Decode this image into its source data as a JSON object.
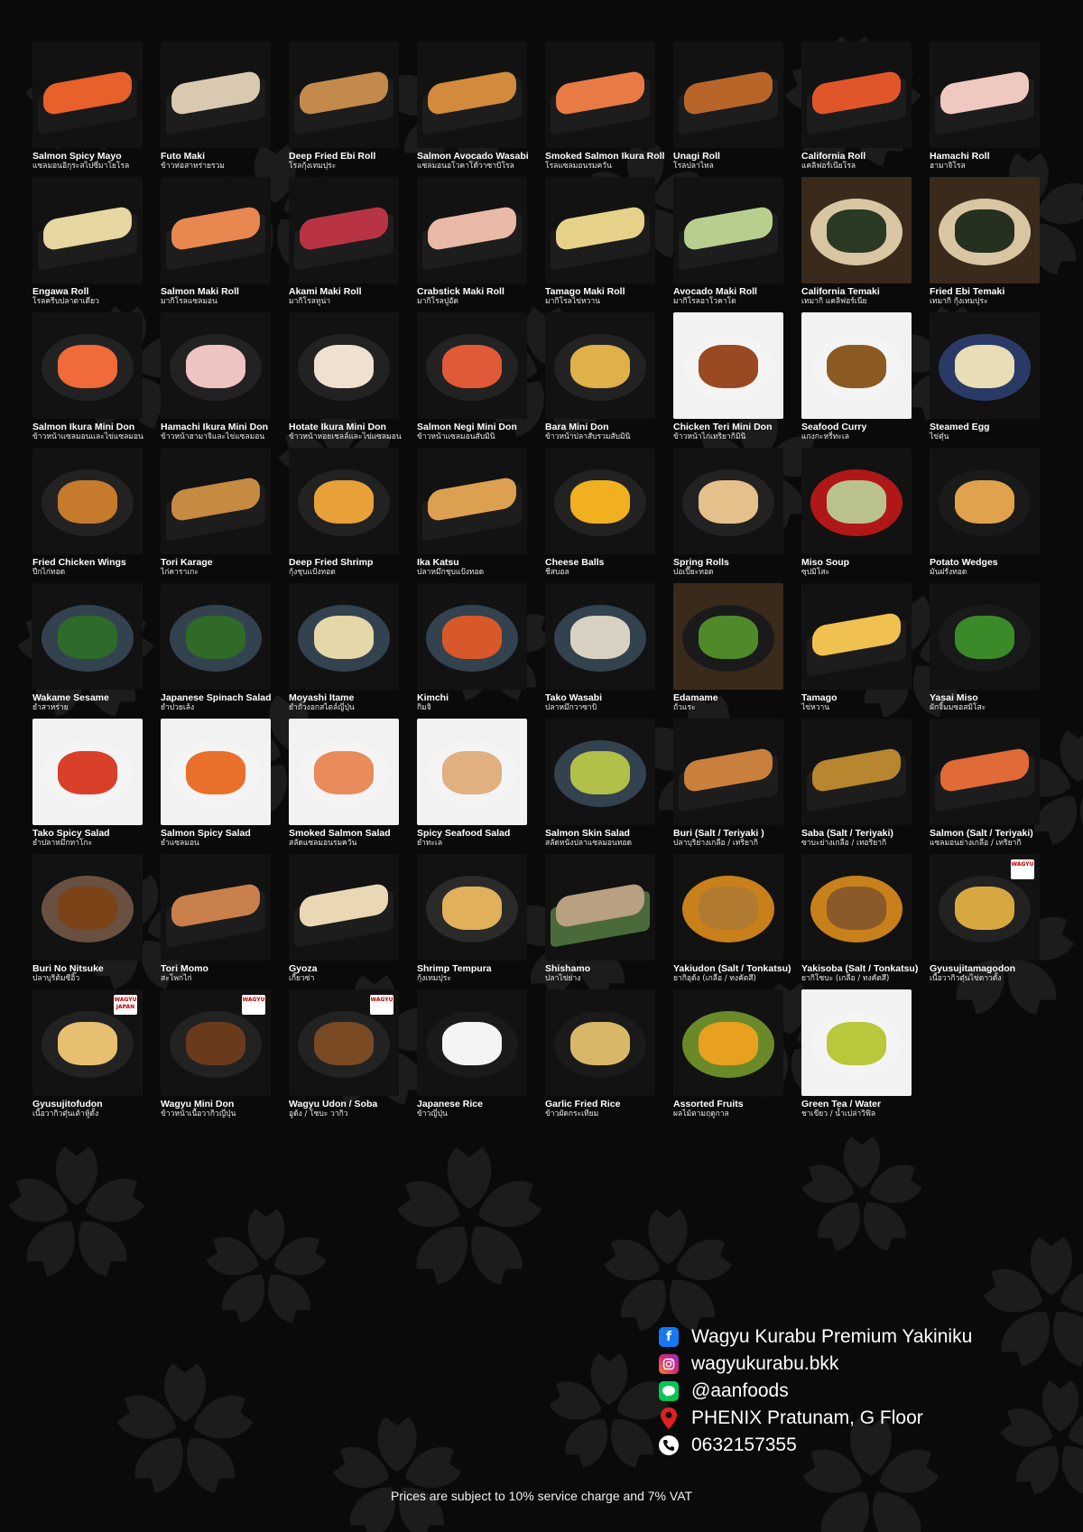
{
  "menu": {
    "items": [
      {
        "name": "Salmon Spicy Mayo",
        "thai": "แซลมอนอิกุระสไปซี่มาโยโรล",
        "style": "tray",
        "food": "#e8602a",
        "plate": "#1a1a1a"
      },
      {
        "name": "Futo Maki",
        "thai": "ข้าวห่อสาหร่ายรวม",
        "style": "tray",
        "food": "#d9c9b0",
        "plate": "#1d1d1d"
      },
      {
        "name": "Deep Fried Ebi Roll",
        "thai": "โรลกุ้งเทมปุระ",
        "style": "tray",
        "food": "#c48a4c",
        "plate": "#1d1d1d"
      },
      {
        "name": "Salmon Avocado Wasabi",
        "thai": "แซลมอนอโวคาโด้วาซาบิโรล",
        "style": "tray",
        "food": "#d28a3c",
        "plate": "#1d1d1d"
      },
      {
        "name": "Smoked Salmon Ikura Roll",
        "thai": "โรลแซลมอนรมควัน",
        "style": "tray",
        "food": "#e87b45",
        "plate": "#1d1d1d"
      },
      {
        "name": "Unagi Roll",
        "thai": "โรลปลาไหล",
        "style": "tray",
        "food": "#b8652a",
        "plate": "#1d1d1d"
      },
      {
        "name": "California Roll",
        "thai": "แคลิฟอร์เนียโรล",
        "style": "tray",
        "food": "#e0562a",
        "plate": "#1d1d1d"
      },
      {
        "name": "Hamachi Roll",
        "thai": "ฮามาจิโรล",
        "style": "tray",
        "food": "#efc9c0",
        "plate": "#1d1d1d"
      },
      {
        "name": "Engawa Roll",
        "thai": "โรลครีบปลาตาเดียว",
        "style": "tray",
        "food": "#e6d7a0",
        "plate": "#1d1d1d"
      },
      {
        "name": "Salmon Maki Roll",
        "thai": "มากิโรลแซลมอน",
        "style": "tray",
        "food": "#e8874f",
        "plate": "#1d1d1d"
      },
      {
        "name": "Akami Maki Roll",
        "thai": "มากิโรลทูน่า",
        "style": "tray",
        "food": "#b83444",
        "plate": "#1d1d1d"
      },
      {
        "name": "Crabstick Maki Roll",
        "thai": "มากิโรลปูอัด",
        "style": "tray",
        "food": "#e8b9a6",
        "plate": "#1d1d1d"
      },
      {
        "name": "Tamago Maki Roll",
        "thai": "มากิโรลไข่หวาน",
        "style": "tray",
        "food": "#e6d189",
        "plate": "#1d1d1d"
      },
      {
        "name": "Avocado Maki Roll",
        "thai": "มากิโรลอาโวคาโด",
        "style": "tray",
        "food": "#b6cf8f",
        "plate": "#1d1d1d"
      },
      {
        "name": "California Temaki",
        "thai": "เทมากิ แคลิฟอร์เนีย",
        "style": "wood",
        "food": "#2b3a22",
        "plate": "#d8c6a2"
      },
      {
        "name": "Fried Ebi Temaki",
        "thai": "เทมากิ กุ้งเทมปุระ",
        "style": "wood",
        "food": "#26301e",
        "plate": "#d8c6a2"
      },
      {
        "name": "Salmon Ikura Mini Don",
        "thai": "ข้าวหน้าแซลมอนและไข่แซลมอน",
        "style": "bowl",
        "food": "#f06a3a",
        "plate": "#222"
      },
      {
        "name": "Hamachi Ikura Mini Don",
        "thai": "ข้าวหน้าฮามาจิและไข่แซลมอน",
        "style": "bowl",
        "food": "#f0c3c3",
        "plate": "#222"
      },
      {
        "name": "Hotate Ikura Mini Don",
        "thai": "ข้าวหน้าหอยเชลล์และไข่แซลมอน",
        "style": "bowl",
        "food": "#efe1cf",
        "plate": "#222"
      },
      {
        "name": "Salmon Negi Mini Don",
        "thai": "ข้าวหน้าแซลมอนสับมินิ",
        "style": "bowl",
        "food": "#e05a38",
        "plate": "#222"
      },
      {
        "name": "Bara Mini Don",
        "thai": "ข้าวหน้าปลาสับรวมสับมินิ",
        "style": "bowl",
        "food": "#e0b04a",
        "plate": "#222"
      },
      {
        "name": "Chicken Teri Mini Don",
        "thai": "ข้าวหน้าไก่เทริยากิมินิ",
        "style": "white-plate",
        "food": "#9a4a22",
        "plate": "#f4f4f4"
      },
      {
        "name": "Seafood Curry",
        "thai": "แกงกะหรี่ทะเล",
        "style": "white-plate",
        "food": "#8a5a22",
        "plate": "#f4f4f4"
      },
      {
        "name": "Steamed Egg",
        "thai": "ไข่ตุ๋น",
        "style": "bowl",
        "food": "#e8ddb6",
        "plate": "#2a3a66"
      },
      {
        "name": "Fried Chicken Wings",
        "thai": "ปีกไก่ทอด",
        "style": "bowl",
        "food": "#c57a2c",
        "plate": "#222"
      },
      {
        "name": "Tori Karage",
        "thai": "ไก่คาราเกะ",
        "style": "tray",
        "food": "#c78a42",
        "plate": "#1d1d1d"
      },
      {
        "name": "Deep Fried Shrimp",
        "thai": "กุ้งชุบแป้งทอด",
        "style": "bowl",
        "food": "#e8a038",
        "plate": "#222"
      },
      {
        "name": "Ika Katsu",
        "thai": "ปลาหมึกชุบแป้งทอด",
        "style": "tray",
        "food": "#dca050",
        "plate": "#1d1d1d"
      },
      {
        "name": "Cheese Balls",
        "thai": "ชีสบอล",
        "style": "bowl",
        "food": "#f0b020",
        "plate": "#222"
      },
      {
        "name": "Spring Rolls",
        "thai": "ปอเปี๊ยะทอด",
        "style": "bowl",
        "food": "#e6c08a",
        "plate": "#222"
      },
      {
        "name": "Miso Soup",
        "thai": "ซุปมิโสะ",
        "style": "bowl",
        "food": "#b8c28a",
        "plate": "#b01818"
      },
      {
        "name": "Potato Wedges",
        "thai": "มันฝรั่งทอด",
        "style": "bowl",
        "food": "#e0a24c",
        "plate": "#1a1a1a"
      },
      {
        "name": "Wakame Sesame",
        "thai": "ยำสาหร่าย",
        "style": "bowl",
        "food": "#2e6a2a",
        "plate": "#33424f"
      },
      {
        "name": "Japanese Spinach Salad",
        "thai": "ยำปวยเล้ง",
        "style": "bowl",
        "food": "#2f6a28",
        "plate": "#33424f"
      },
      {
        "name": "Moyashi Itame",
        "thai": "ยำถั่วงอกสไตล์ญี่ปุ่น",
        "style": "bowl",
        "food": "#e6d7a8",
        "plate": "#33424f"
      },
      {
        "name": "Kimchi",
        "thai": "กิมจิ",
        "style": "bowl",
        "food": "#d8582a",
        "plate": "#33424f"
      },
      {
        "name": "Tako Wasabi",
        "thai": "ปลาหมึกวาซาบิ",
        "style": "bowl",
        "food": "#d8d0c0",
        "plate": "#33424f"
      },
      {
        "name": "Edamame",
        "thai": "ถั่วแระ",
        "style": "wood",
        "food": "#4e8a2a",
        "plate": "#1a1a1a"
      },
      {
        "name": "Tamago",
        "thai": "ไข่หวาน",
        "style": "tray",
        "food": "#f0c050",
        "plate": "#1d1d1d"
      },
      {
        "name": "Yasai Miso",
        "thai": "ผักจิ้มมซอสมิโสะ",
        "style": "bowl",
        "food": "#3a8a2a",
        "plate": "#1a1a1a"
      },
      {
        "name": "Tako Spicy Salad",
        "thai": "ยำปลาหมึกทาโกะ",
        "style": "white-plate",
        "food": "#d8402a",
        "plate": "#f4f4f4"
      },
      {
        "name": "Salmon Spicy Salad",
        "thai": "ยำแซลมอน",
        "style": "white-plate",
        "food": "#e8702a",
        "plate": "#f4f4f4"
      },
      {
        "name": "Smoked Salmon Salad",
        "thai": "สลัดแซลมอนรมควัน",
        "style": "white-plate",
        "food": "#e88a5a",
        "plate": "#f4f4f4"
      },
      {
        "name": "Spicy Seafood Salad",
        "thai": "ยำทะเล",
        "style": "white-plate",
        "food": "#e0b080",
        "plate": "#f4f4f4"
      },
      {
        "name": "Salmon Skin Salad",
        "thai": "สลัดหนังปลาแซลมอนทอด",
        "style": "bowl",
        "food": "#b0c048",
        "plate": "#33424f"
      },
      {
        "name": "Buri (Salt / Teriyaki )",
        "thai": "ปลาบุริย่างเกลือ / เทริยากิ",
        "style": "tray",
        "food": "#c9803c",
        "plate": "#1d1d1d"
      },
      {
        "name": "Saba (Salt / Teriyaki)",
        "thai": "ซาบะย่างเกลือ / เทอริยากิ",
        "style": "tray",
        "food": "#b8862e",
        "plate": "#1d1d1d"
      },
      {
        "name": "Salmon (Salt / Teriyaki)",
        "thai": "แซลมอนย่างเกลือ / เทริยากิ",
        "style": "tray",
        "food": "#e06a38",
        "plate": "#1d1d1d"
      },
      {
        "name": "Buri No Nitsuke",
        "thai": "ปลาบุริต้มซีอิ๊ว",
        "style": "bowl",
        "food": "#7a4418",
        "plate": "#6a5040"
      },
      {
        "name": "Tori Momo",
        "thai": "สะโพกไก่",
        "style": "tray",
        "food": "#c9804c",
        "plate": "#1d1d1d"
      },
      {
        "name": "Gyoza",
        "thai": "เกี๊ยวซ่า",
        "style": "tray",
        "food": "#ead8b4",
        "plate": "#1d1d1d"
      },
      {
        "name": "Shrimp Tempura",
        "thai": "กุ้งเทมปุระ",
        "style": "bowl",
        "food": "#e0b05a",
        "plate": "#2a2a2a"
      },
      {
        "name": "Shishamo",
        "thai": "ปลาไข่ย่าง",
        "style": "tray",
        "food": "#b8a080",
        "plate": "#4a6a3a"
      },
      {
        "name": "Yakiudon (Salt / Tonkatsu)",
        "thai": "ยากิอุด้ง (เกลือ / ทงคัตสึ)",
        "style": "bowl",
        "food": "#b07a30",
        "plate": "#c8801a"
      },
      {
        "name": "Yakisoba (Salt / Tonkatsu)",
        "thai": "ยากิโซบะ (เกลือ / ทงคัตสึ)",
        "style": "bowl",
        "food": "#8a5a2a",
        "plate": "#c8801a"
      },
      {
        "name": "Gyusujitamagodon",
        "thai": "เนื้อวากิวตุ๋นไข่ดาวดั้ง",
        "style": "bowl",
        "food": "#d8a840",
        "plate": "#222",
        "badge": "WAGYU"
      },
      {
        "name": "Gyusujitofudon",
        "thai": "เนื้อวากิวตุ๋นเต้าหู้ดั้ง",
        "style": "bowl",
        "food": "#e6c070",
        "plate": "#222",
        "badge": "WAGYU JAPAN"
      },
      {
        "name": "Wagyu Mini Don",
        "thai": "ข้าวหน้าเนื้อวากิวญี่ปุ่น",
        "style": "bowl",
        "food": "#6a3a1c",
        "plate": "#222",
        "badge": "WAGYU"
      },
      {
        "name": "Wagyu Udon / Soba",
        "thai": "อูด้ง / โซบะ วากิว",
        "style": "bowl",
        "food": "#7a4a24",
        "plate": "#222",
        "badge": "WAGYU"
      },
      {
        "name": "Japanese Rice",
        "thai": "ข้าวญี่ปุ่น",
        "style": "bowl",
        "food": "#f4f4f4",
        "plate": "#1a1a1a"
      },
      {
        "name": "Garlic Fried Rice",
        "thai": "ข้าวผัดกระเทียม",
        "style": "bowl",
        "food": "#d8b868",
        "plate": "#1a1a1a"
      },
      {
        "name": "Assorted Fruits",
        "thai": "ผลไม้ตามฤดูกาล",
        "style": "bowl",
        "food": "#e8a020",
        "plate": "#6a8a2a"
      },
      {
        "name": "Green Tea / Water",
        "thai": "ชาเขียว / น้ำเปล่าวิฟิล",
        "style": "white-plate",
        "food": "#b8c83a",
        "plate": "#f4f4f4"
      }
    ]
  },
  "contact": {
    "facebook": "Wagyu Kurabu Premium Yakiniku",
    "instagram": "wagyukurabu.bkk",
    "line": "@aanfoods",
    "location": "PHENIX Pratunam, G Floor",
    "phone": "0632157355"
  },
  "footer": {
    "note": "Prices are subject to 10% service charge and 7% VAT"
  },
  "colors": {
    "background": "#0a0a0a",
    "pattern": "#1e1e1e",
    "facebook": "#1877f2",
    "instagram": "#d62976",
    "line": "#06c755",
    "location": "#e02020"
  }
}
